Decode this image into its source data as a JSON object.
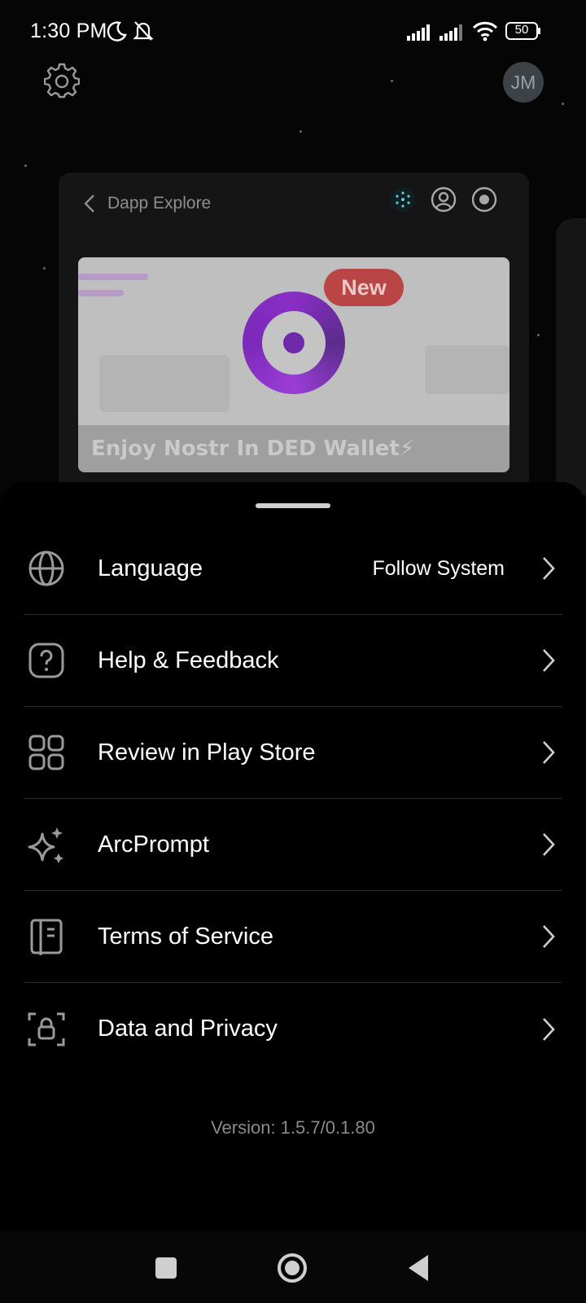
{
  "status_bar": {
    "time": "1:30 PM",
    "battery": "50",
    "icons": [
      "moon-icon",
      "bell-off-icon",
      "signal-icon",
      "signal-icon",
      "wifi-icon",
      "battery-icon"
    ]
  },
  "header": {
    "settings_icon": "gear-icon",
    "avatar_initials": "JM"
  },
  "background_card": {
    "title": "Dapp Explore",
    "icons": [
      "network-icon",
      "profile-icon",
      "record-icon"
    ],
    "banner": {
      "badge": "New",
      "text": "Enjoy Nostr In DED Wallet⚡"
    }
  },
  "sheet": {
    "items": [
      {
        "icon": "globe-icon",
        "label": "Language",
        "value": "Follow System"
      },
      {
        "icon": "help-icon",
        "label": "Help & Feedback",
        "value": ""
      },
      {
        "icon": "apps-grid-icon",
        "label": "Review in Play Store",
        "value": ""
      },
      {
        "icon": "sparkle-icon",
        "label": "ArcPrompt",
        "value": ""
      },
      {
        "icon": "book-icon",
        "label": "Terms of Service",
        "value": ""
      },
      {
        "icon": "lock-icon",
        "label": "Data and Privacy",
        "value": ""
      }
    ],
    "version": "Version: 1.5.7/0.1.80"
  },
  "nav_bar": {
    "buttons": [
      "recents-button",
      "home-button",
      "back-button"
    ]
  },
  "colors": {
    "background": "#000000",
    "divider": "#2b2b2b",
    "text_primary": "#ffffff",
    "text_secondary": "#8a8a8a",
    "badge": "#b94545",
    "logo": "#8a2ec6"
  }
}
